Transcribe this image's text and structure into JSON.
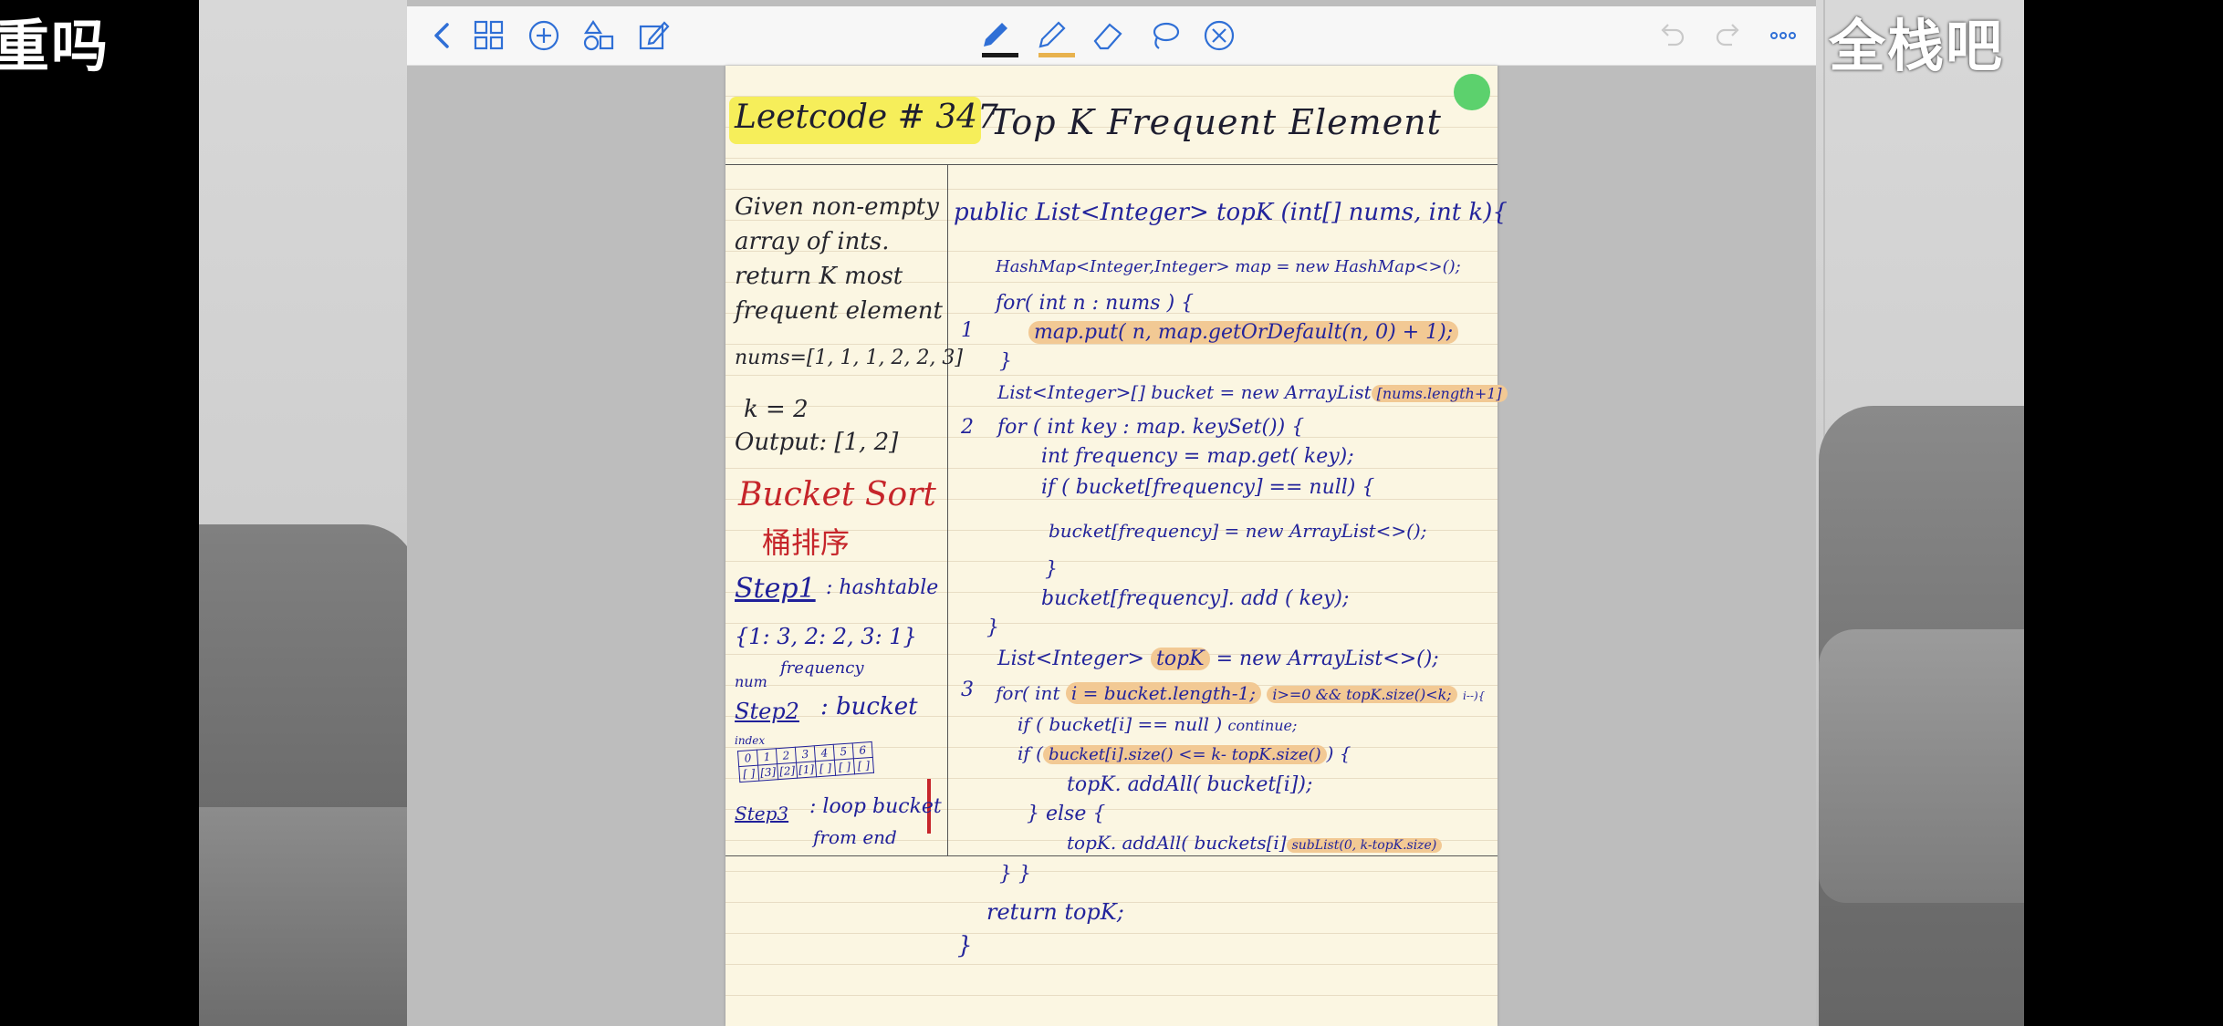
{
  "captions": {
    "left": "重吗",
    "right": "全栈吧"
  },
  "toolbar": {
    "left_icons": [
      "back-chevron-icon",
      "grid-icon",
      "add-circle-icon",
      "shapes-icon",
      "edit-note-icon"
    ],
    "tool_icons": [
      "pen-icon",
      "highlighter-icon",
      "eraser-icon",
      "lasso-icon",
      "close-circle-icon"
    ],
    "right_icons": [
      "undo-icon",
      "redo-icon",
      "more-icon"
    ],
    "colors": {
      "pen": "#1a1a1a",
      "highlighter": "#e8b24e",
      "accent": "#2f6fd6"
    }
  },
  "note": {
    "title_label": "Leetcode # 347",
    "title_text": "Top  K  Frequent  Element",
    "problem": [
      "Given non-empty",
      "array of ints.",
      "return K most",
      "frequent element",
      "nums=[1, 1, 1, 2, 2, 3]",
      "k = 2",
      "Output: [1, 2]"
    ],
    "bucket_sort": "Bucket Sort",
    "bucket_sort_cn": "桶排序",
    "step1": "Step1",
    "step1_desc": ": hashtable",
    "hashtable": "{1: 3, 2: 2, 3: 1}",
    "num_label": "num",
    "freq_label": "frequency",
    "step2": "Step2",
    "step2_desc": ": bucket",
    "index_label": "index",
    "bucket_index": [
      "0",
      "1",
      "2",
      "3",
      "4",
      "5",
      "6"
    ],
    "bucket_values": [
      "[ ]",
      "[3]",
      "[2]",
      "[1]",
      "[ ]",
      "[ ]",
      "[ ]"
    ],
    "step3": "Step3",
    "step3_desc": ": loop bucket",
    "step3_desc2": "from end",
    "code": {
      "signature": "public List<Integer> topK (int[] nums, int k){",
      "l1": "HashMap<Integer,Integer> map = new HashMap<>();",
      "l2": "for( int n : nums ) {",
      "l3": "map.put( n, map.getOrDefault(n, 0) + 1);",
      "l4": "}",
      "l5a": "List<Integer>[] bucket = new ArrayList",
      "l5b": "[nums.length+1]",
      "l6": "for ( int key : map. keySet()) {",
      "l7": "int frequency = map.get( key);",
      "l8": "if ( bucket[frequency] == null) {",
      "l9": "bucket[frequency] = new ArrayList<>();",
      "l10": "}",
      "l11": "bucket[frequency]. add ( key);",
      "l12": "}",
      "l13a": "List<Integer>",
      "l13b": "topK",
      "l13c": "= new ArrayList<>();",
      "l14a": "for( int",
      "l14b": "i = bucket.length-1;",
      "l14c": "i>=0 && topK.size()<k;",
      "l14d": "i--){",
      "l15a": "if ( bucket[i] == null )",
      "l15b": "continue;",
      "l16a": "if (",
      "l16b": "bucket[i].size() <= k- topK.size()",
      "l16c": ") {",
      "l17": "topK. addAll( bucket[i]);",
      "l18": "} else {",
      "l19a": "topK. addAll( buckets[i]",
      "l19b": "subList(0, k-topK.size)",
      "l20": "}  }",
      "l21": "return topK;",
      "l22": "}",
      "step_markers": [
        "1",
        "2",
        "3"
      ]
    }
  }
}
